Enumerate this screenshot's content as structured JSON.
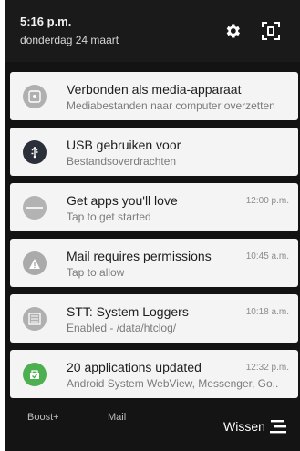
{
  "header": {
    "time": "5:16 p.m.",
    "date": "donderdag 24 maart",
    "icons": [
      "gear-icon",
      "screenshot-icon"
    ]
  },
  "notifications": [
    {
      "title": "Verbonden als media-apparaat",
      "subtitle": "Mediabestanden naar computer overzetten",
      "time": "",
      "icon": "media-device-icon",
      "icon_color": "#b0b0b0"
    },
    {
      "title": "USB gebruiken voor",
      "subtitle": "Bestandsoverdrachten",
      "time": "",
      "icon": "usb-icon",
      "icon_color": "#2b2f3a"
    },
    {
      "title": "Get apps you'll love",
      "subtitle": "Tap to get started",
      "time": "12:00 p.m.",
      "icon": "htc-icon",
      "icon_color": "#b3b3b3"
    },
    {
      "title": "Mail requires permissions",
      "subtitle": "Tap to allow",
      "time": "10:45 a.m.",
      "icon": "warning-icon",
      "icon_color": "#aaaaaa"
    },
    {
      "title": "STT: System Loggers",
      "subtitle": "Enabled - /data/htclog/",
      "time": "10:18 a.m.",
      "icon": "logger-icon",
      "icon_color": "#b0b0b0"
    },
    {
      "title": "20 applications updated",
      "subtitle": "Android System WebView, Messenger, Go..",
      "time": "12:32 p.m.",
      "icon": "app-update-icon",
      "icon_color": "#4caf50"
    }
  ],
  "footer": {
    "boost": "Boost+",
    "mail": "Mail",
    "clear": "Wissen"
  },
  "colors": {
    "background": "#131313",
    "card": "#f4f4f4",
    "accent_green": "#4caf50"
  }
}
